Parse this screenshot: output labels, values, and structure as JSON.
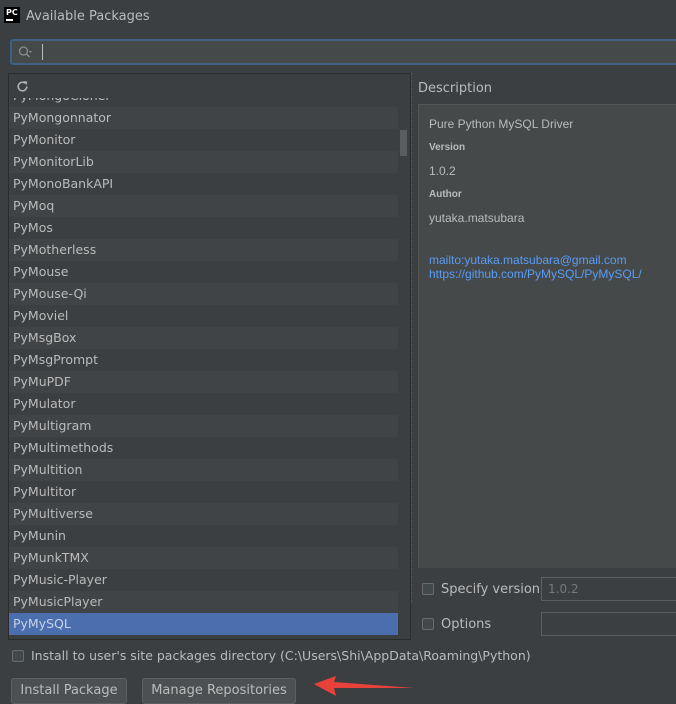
{
  "window": {
    "title": "Available Packages",
    "app_icon_text": "PC"
  },
  "search": {
    "value": "",
    "placeholder": ""
  },
  "packages": [
    "PyMongoCloner",
    "PyMongonnator",
    "PyMonitor",
    "PyMonitorLib",
    "PyMonoBankAPI",
    "PyMoq",
    "PyMos",
    "PyMotherless",
    "PyMouse",
    "PyMouse-Qi",
    "PyMoviel",
    "PyMsgBox",
    "PyMsgPrompt",
    "PyMuPDF",
    "PyMulator",
    "PyMultigram",
    "PyMultimethods",
    "PyMultition",
    "PyMultitor",
    "PyMultiverse",
    "PyMunin",
    "PyMunkTMX",
    "PyMusic-Player",
    "PyMusicPlayer",
    "PyMySQL"
  ],
  "selected_package": "PyMySQL",
  "description": {
    "label": "Description",
    "summary": "Pure Python MySQL Driver",
    "version_heading": "Version",
    "version": "1.0.2",
    "author_heading": "Author",
    "author": "yutaka.matsubara",
    "email_link": "mailto:yutaka.matsubara@gmail.com",
    "homepage_link": "https://github.com/PyMySQL/PyMySQL/"
  },
  "options": {
    "specify_version_label": "Specify version",
    "specify_version_value": "1.0.2",
    "specify_version_checked": false,
    "options_label": "Options",
    "options_value": "",
    "options_checked": false,
    "install_user_label": "Install to user's site packages directory (C:\\Users\\Shi\\AppData\\Roaming\\Python)",
    "install_user_checked": false
  },
  "buttons": {
    "install": "Install Package",
    "manage": "Manage Repositories"
  },
  "colors": {
    "background": "#3c3f41",
    "selection": "#4b6eaf",
    "link": "#589df6",
    "annotation_arrow": "#e8413a"
  },
  "icons": {
    "app": "pycharm-icon",
    "search": "search-icon",
    "refresh": "refresh-icon",
    "annotation": "red-arrow-icon"
  }
}
